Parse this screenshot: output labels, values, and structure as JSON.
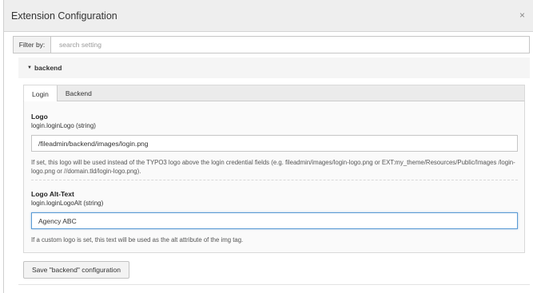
{
  "modal": {
    "title": "Extension Configuration",
    "close_glyph": "×"
  },
  "filter": {
    "label": "Filter by:",
    "placeholder": "search setting",
    "value": ""
  },
  "section": {
    "title": "backend",
    "caret": "▼"
  },
  "tabs": [
    {
      "label": "Login",
      "active": true
    },
    {
      "label": "Backend",
      "active": false
    }
  ],
  "fields": {
    "logo": {
      "title": "Logo",
      "key": "login.loginLogo (string)",
      "value": "/fileadmin/backend/images/login.png",
      "help": "If set, this logo will be used instead of the TYPO3 logo above the login credential fields (e.g. fileadmin/images/login-logo.png or EXT:my_theme/Resources/Public/Images /login-logo.png or //domain.tld/login-logo.png)."
    },
    "logo_alt": {
      "title": "Logo Alt-Text",
      "key": "login.loginLogoAlt (string)",
      "value": "Agency ABC",
      "help": "If a custom logo is set, this text will be used as the alt attribute of the img tag."
    }
  },
  "save_button": {
    "label": "Save \"backend\" configuration"
  },
  "colors": {
    "focus_border": "#5b9bd5",
    "header_bg": "#eeeeee"
  }
}
